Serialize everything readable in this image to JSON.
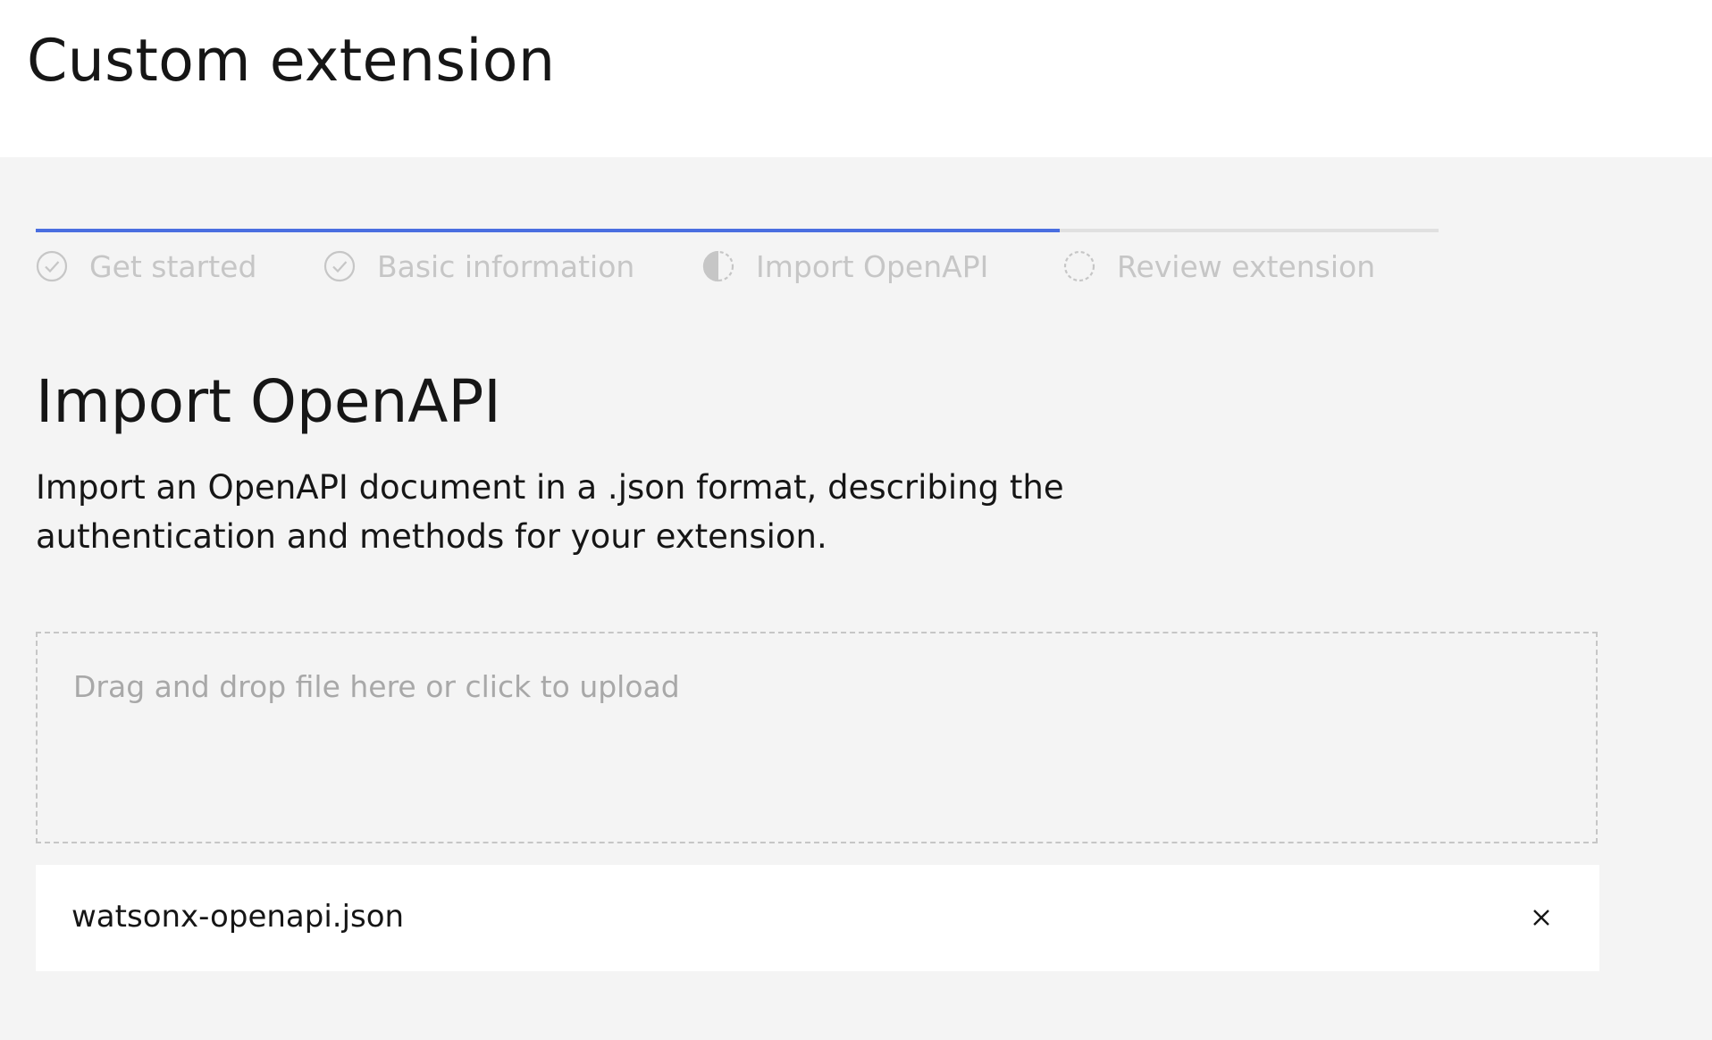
{
  "header": {
    "title": "Custom extension"
  },
  "progress": {
    "completed_fraction": 0.73,
    "accent_color": "#4a6ee0",
    "track_color": "#e0e0e0",
    "steps": [
      {
        "label": "Get started",
        "state": "complete",
        "icon": "checkmark-circle-icon"
      },
      {
        "label": "Basic information",
        "state": "complete",
        "icon": "checkmark-circle-icon"
      },
      {
        "label": "Import OpenAPI",
        "state": "current",
        "icon": "half-filled-circle-icon"
      },
      {
        "label": "Review extension",
        "state": "incomplete",
        "icon": "dashed-circle-icon"
      }
    ]
  },
  "main": {
    "title": "Import OpenAPI",
    "description": "Import an OpenAPI document in a .json format, describing the authentication and methods for your extension."
  },
  "uploader": {
    "dropzone_label": "Drag and drop file here or click to upload",
    "file_name": "watsonx-openapi.json",
    "remove_icon": "close-icon"
  }
}
